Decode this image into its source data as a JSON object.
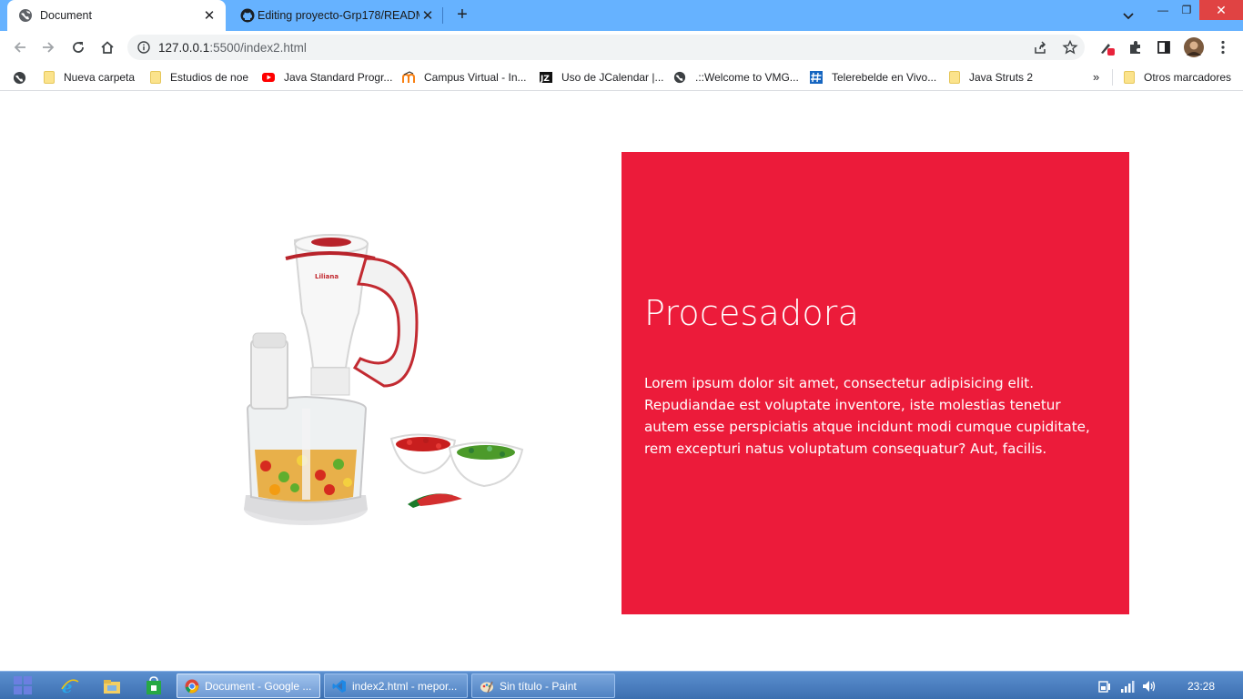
{
  "browser": {
    "tabs": [
      {
        "title": "Document",
        "active": true
      },
      {
        "title": "Editing proyecto-Grp178/READM",
        "active": false
      }
    ],
    "new_tab_label": "+",
    "window_controls": {
      "minimize": "—",
      "restore": "❐",
      "close": "✕"
    },
    "address": {
      "host": "127.0.0.1",
      "path": ":5500/index2.html"
    },
    "bookmarks": [
      {
        "label": "Nueva carpeta",
        "icon": "folder-icon"
      },
      {
        "label": "Estudios de noe",
        "icon": "folder-icon"
      },
      {
        "label": "Java Standard Progr...",
        "icon": "youtube-icon"
      },
      {
        "label": "Campus Virtual - In...",
        "icon": "moodle-icon"
      },
      {
        "label": "Uso de JCalendar |...",
        "icon": "jz-icon"
      },
      {
        "label": ".::Welcome to VMG...",
        "icon": "globe-icon"
      },
      {
        "label": "Telerebelde en Vivo...",
        "icon": "hash-icon"
      },
      {
        "label": "Java Struts 2",
        "icon": "folder-icon"
      }
    ],
    "bookmarks_more": "»",
    "other_bookmarks": "Otros marcadores"
  },
  "page": {
    "card": {
      "title": "Procesadora",
      "body": "Lorem ipsum dolor sit amet, consectetur adipisicing elit. Repudiandae est voluptate inventore, iste molestias tenetur autem esse perspiciatis atque incidunt modi cumque cupiditate, rem excepturi natus voluptatum consequatur? Aut, facilis.",
      "background": "#ec1b3a"
    },
    "product_brand": "Liliana"
  },
  "taskbar": {
    "tasks": [
      {
        "label": "Document - Google ...",
        "icon": "chrome-icon",
        "active": true
      },
      {
        "label": "index2.html - mepor...",
        "icon": "vscode-icon",
        "active": false
      },
      {
        "label": "Sin título - Paint",
        "icon": "paint-icon",
        "active": false
      }
    ],
    "clock": "23:28"
  }
}
